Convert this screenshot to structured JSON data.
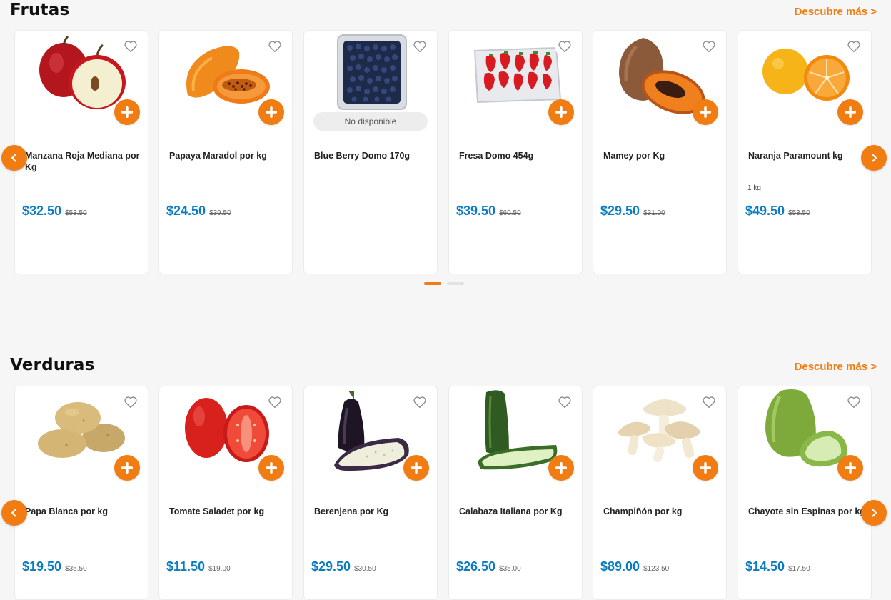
{
  "colors": {
    "accent": "#f07c12",
    "price": "#0a7cc1",
    "background": "#f6f6f6"
  },
  "frutas": {
    "title": "Frutas",
    "discover": "Descubre más >",
    "products": [
      {
        "name": "Manzana Roja Mediana por Kg",
        "price": "$32.50",
        "old_price": "$53.50",
        "image": "apple"
      },
      {
        "name": "Papaya Maradol por kg",
        "price": "$24.50",
        "old_price": "$39.50",
        "image": "papaya"
      },
      {
        "name": "Blue Berry Domo 170g",
        "unavailable": "No disponible",
        "image": "blueberry"
      },
      {
        "name": "Fresa Domo 454g",
        "price": "$39.50",
        "old_price": "$60.50",
        "image": "strawberry"
      },
      {
        "name": "Mamey por Kg",
        "price": "$29.50",
        "old_price": "$31.00",
        "image": "mamey"
      },
      {
        "name": "Naranja Paramount kg",
        "unit": "1 kg",
        "price": "$49.50",
        "old_price": "$53.50",
        "image": "orange"
      }
    ]
  },
  "verduras": {
    "title": "Verduras",
    "discover": "Descubre más >",
    "products": [
      {
        "name": "Papa Blanca por kg",
        "price": "$19.50",
        "old_price": "$35.50",
        "image": "potato"
      },
      {
        "name": "Tomate Saladet por kg",
        "price": "$11.50",
        "old_price": "$19.00",
        "image": "tomato"
      },
      {
        "name": "Berenjena por Kg",
        "price": "$29.50",
        "old_price": "$30.50",
        "image": "eggplant"
      },
      {
        "name": "Calabaza Italiana por Kg",
        "price": "$26.50",
        "old_price": "$35.00",
        "image": "zucchini"
      },
      {
        "name": "Champiñón por kg",
        "price": "$89.00",
        "old_price": "$123.50",
        "image": "mushroom"
      },
      {
        "name": "Chayote sin Espinas por kg",
        "price": "$14.50",
        "old_price": "$17.50",
        "image": "chayote"
      }
    ]
  },
  "icons": {
    "heart": "heart-icon",
    "add": "plus-icon",
    "prev": "chevron-left-icon",
    "next": "chevron-right-icon"
  }
}
